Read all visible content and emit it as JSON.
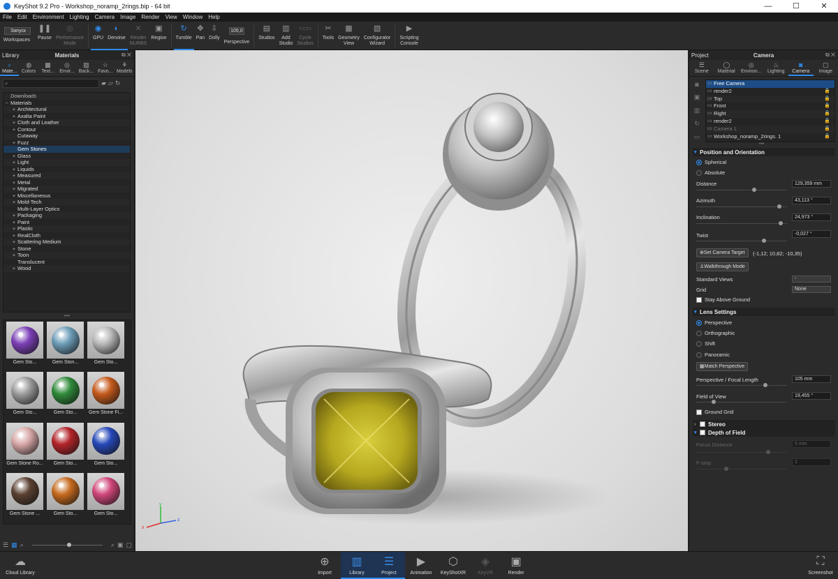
{
  "window": {
    "title": "KeyShot 9.2 Pro  -  Workshop_noramp_2rings.bip  - 64 bit",
    "minimize": "—",
    "maximize": "☐",
    "close": "✕"
  },
  "menu": [
    "File",
    "Edit",
    "Environment",
    "Lighting",
    "Camera",
    "Image",
    "Render",
    "View",
    "Window",
    "Help"
  ],
  "toolbar": {
    "workspace_value": "Запуск",
    "workspaces": "Workspaces",
    "pause": "Pause",
    "performance": "Performance\nMode",
    "gpu": "GPU",
    "denoise": "Denoise",
    "render_nurbs": "Render\nNURBS",
    "region": "Region",
    "tumble": "Tumble",
    "pan": "Pan",
    "dolly": "Dolly",
    "focal_value": "105,0",
    "perspective": "Perspective",
    "studios": "Studios",
    "add_studio": "Add\nStudio",
    "cycle_studios": "Cycle\nStudios",
    "tools": "Tools",
    "geometry_view": "Geometry\nView",
    "configurator": "Configurator\nWizard",
    "scripting": "Scripting\nConsole"
  },
  "library": {
    "panel_label": "Library",
    "title": "Materials",
    "tabs": [
      "Mate...",
      "Colors",
      "Text...",
      "Envir...",
      "Back...",
      "Favo...",
      "Models"
    ],
    "tree": [
      {
        "label": "Downloads",
        "type": "italic"
      },
      {
        "label": "Materials",
        "pm": "−"
      },
      {
        "label": "Architectural",
        "pm": "+",
        "indent": 1
      },
      {
        "label": "Axalta Paint",
        "pm": "+",
        "indent": 1
      },
      {
        "label": "Cloth and Leather",
        "pm": "+",
        "indent": 1
      },
      {
        "label": "Contour",
        "pm": "+",
        "indent": 1
      },
      {
        "label": "Cutaway",
        "pm": "",
        "indent": 1
      },
      {
        "label": "Fuzz",
        "pm": "+",
        "indent": 1
      },
      {
        "label": "Gem Stones",
        "pm": "",
        "indent": 1,
        "selected": true
      },
      {
        "label": "Glass",
        "pm": "+",
        "indent": 1
      },
      {
        "label": "Light",
        "pm": "+",
        "indent": 1
      },
      {
        "label": "Liquids",
        "pm": "+",
        "indent": 1
      },
      {
        "label": "Measured",
        "pm": "+",
        "indent": 1
      },
      {
        "label": "Metal",
        "pm": "+",
        "indent": 1
      },
      {
        "label": "Migrated",
        "pm": "+",
        "indent": 1
      },
      {
        "label": "Miscellaneous",
        "pm": "+",
        "indent": 1
      },
      {
        "label": "Mold-Tech",
        "pm": "+",
        "indent": 1
      },
      {
        "label": "Multi-Layer Optics",
        "pm": "",
        "indent": 1
      },
      {
        "label": "Packaging",
        "pm": "+",
        "indent": 1
      },
      {
        "label": "Paint",
        "pm": "+",
        "indent": 1
      },
      {
        "label": "Plastic",
        "pm": "+",
        "indent": 1
      },
      {
        "label": "RealCloth",
        "pm": "+",
        "indent": 1
      },
      {
        "label": "Scattering Medium",
        "pm": "+",
        "indent": 1
      },
      {
        "label": "Stone",
        "pm": "+",
        "indent": 1
      },
      {
        "label": "Toon",
        "pm": "+",
        "indent": 1
      },
      {
        "label": "Translucent",
        "pm": "",
        "indent": 1
      },
      {
        "label": "Wood",
        "pm": "+",
        "indent": 1
      }
    ],
    "thumbs": [
      {
        "label": "Gem Sto...",
        "color": "#7b3fb6"
      },
      {
        "label": "Gem Ston...",
        "color": "#6d9db8"
      },
      {
        "label": "Gem Sto...",
        "color": "#b9b9b9"
      },
      {
        "label": "Gem Sto...",
        "color": "#9c9c9c"
      },
      {
        "label": "Gem Sto...",
        "color": "#2f8a3a"
      },
      {
        "label": "Gem Stone Fi...",
        "color": "#c45a1c"
      },
      {
        "label": "Gem Stone Ro...",
        "color": "#d8a8a8"
      },
      {
        "label": "Gem Sto...",
        "color": "#b3242a"
      },
      {
        "label": "Gem Sto...",
        "color": "#2648b8"
      },
      {
        "label": "Gem Stone ...",
        "color": "#5a4031"
      },
      {
        "label": "Gem Sto...",
        "color": "#c66a1e"
      },
      {
        "label": "Gem Sto...",
        "color": "#d0467a"
      }
    ]
  },
  "project": {
    "panel_label": "Project",
    "title": "Camera",
    "tabs": [
      "Scene",
      "Material",
      "Environ...",
      "Lighting",
      "Camera",
      "Image"
    ],
    "cameras": [
      {
        "label": "Free Camera",
        "selected": true
      },
      {
        "label": "render2"
      },
      {
        "label": "Top"
      },
      {
        "label": "Front"
      },
      {
        "label": "Right"
      },
      {
        "label": "render2"
      },
      {
        "label": "Camera 1",
        "dim": true
      },
      {
        "label": "Workshop_noramp_2rings. 1"
      }
    ],
    "position_title": "Position and Orientation",
    "spherical": "Spherical",
    "absolute": "Absolute",
    "distance_label": "Distance",
    "distance_value": "129,359 mm",
    "azimuth_label": "Azimuth",
    "azimuth_value": "43,113 °",
    "inclination_label": "Inclination",
    "inclination_value": "24,973 °",
    "twist_label": "Twist",
    "twist_value": "-0,027 °",
    "set_target": "Set Camera Target",
    "target_value": "(-1,12; 10,82; -10,35)",
    "walkthrough": "Walkthrough Mode",
    "standard_views_label": "Standard Views",
    "standard_views_value": "-",
    "grid_label": "Grid",
    "grid_value": "None",
    "stay_above": "Stay Above Ground",
    "lens_title": "Lens Settings",
    "perspective": "Perspective",
    "orthographic": "Orthographic",
    "shift": "Shift",
    "panoramic": "Panoramic",
    "match_perspective": "Match Perspective",
    "focal_label": "Perspective / Focal Length",
    "focal_value": "105 mm",
    "fov_label": "Field of View",
    "fov_value": "19,455 °",
    "ground_grid": "Ground Grid",
    "stereo": "Stereo",
    "dof": "Depth of Field",
    "focus_label": "Focus Distance",
    "focus_value": "5 mm",
    "fstop_label": "F-stop",
    "fstop_value": "1"
  },
  "bottombar": {
    "cloud": "Cloud Library",
    "import": "Import",
    "library": "Library",
    "project": "Project",
    "animation": "Animation",
    "keyshotxr": "KeyShotXR",
    "keyvr": "KeyVR",
    "render": "Render",
    "screenshot": "Screenshot"
  },
  "viewport": {
    "axis_x": "x",
    "axis_y": "y",
    "axis_z": "z"
  }
}
